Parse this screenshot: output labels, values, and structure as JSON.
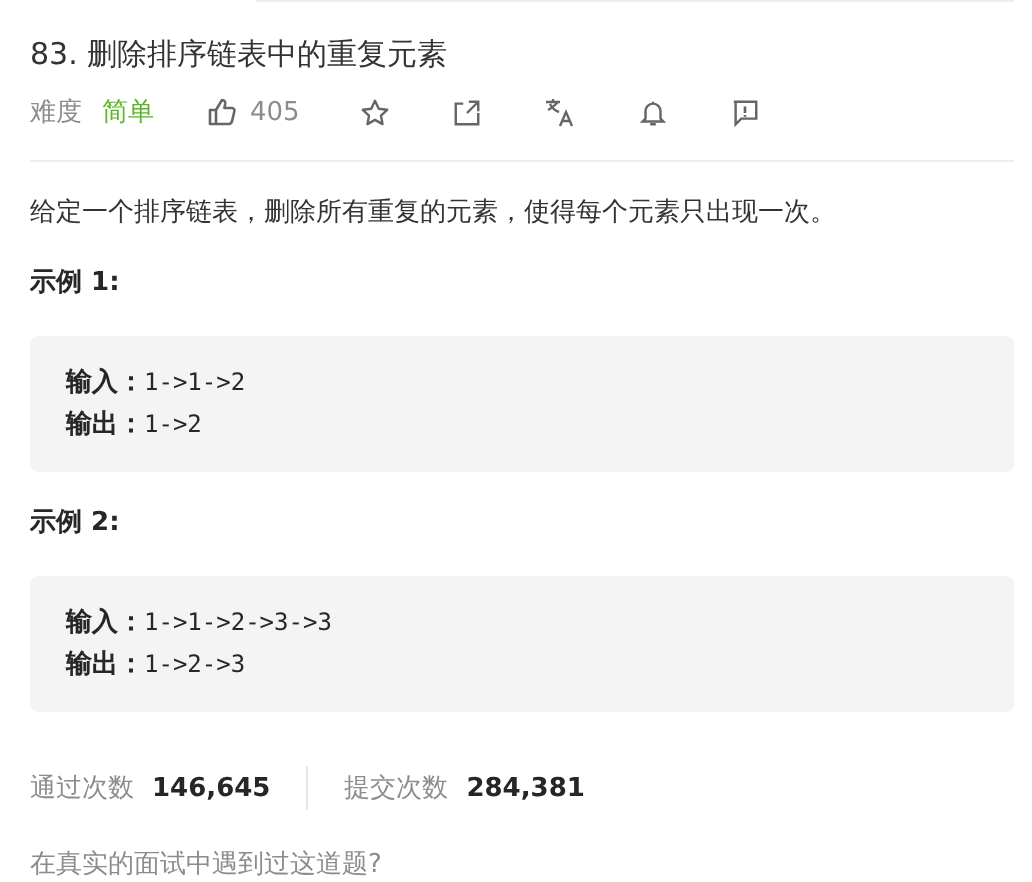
{
  "title": "83. 删除排序链表中的重复元素",
  "meta": {
    "difficulty_label": "难度",
    "difficulty": {
      "label": "简单",
      "kind": "easy"
    },
    "likes": "405"
  },
  "description": "给定一个排序链表，删除所有重复的元素，使得每个元素只出现一次。",
  "examples": [
    {
      "heading": "示例 1:",
      "lines": [
        {
          "label": "输入：",
          "value": "1->1->2"
        },
        {
          "label": "输出：",
          "value": "1->2"
        }
      ]
    },
    {
      "heading": "示例 2:",
      "lines": [
        {
          "label": "输入：",
          "value": "1->1->2->3->3"
        },
        {
          "label": "输出：",
          "value": "1->2->3"
        }
      ]
    }
  ],
  "stats": [
    {
      "label": "通过次数",
      "value": "146,645"
    },
    {
      "label": "提交次数",
      "value": "284,381"
    }
  ],
  "interview_question": "在真实的面试中遇到过这道题?"
}
